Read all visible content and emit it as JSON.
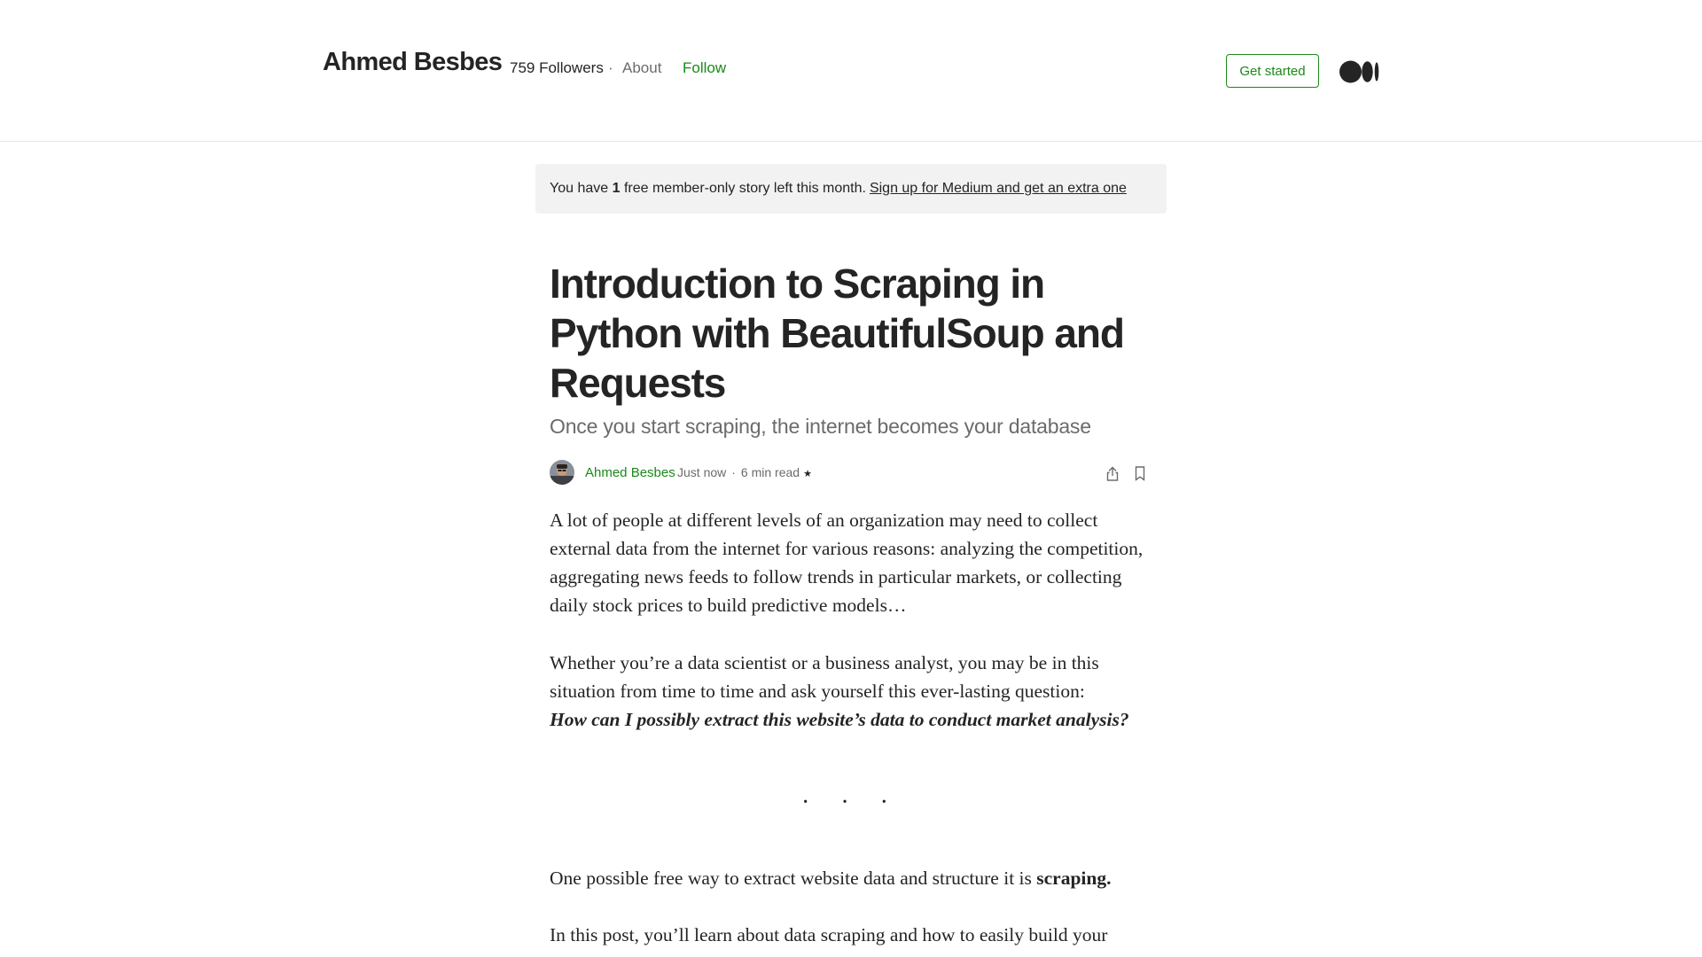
{
  "header": {
    "publication_name": "Ahmed Besbes",
    "followers": "759 Followers",
    "separator": "·",
    "about": "About",
    "follow": "Follow",
    "get_started": "Get started",
    "logo_icon": "medium-logo-icon"
  },
  "banner": {
    "text_before": "You have",
    "count": "1",
    "text_after": "free member-only story left this month.",
    "signup_link": "Sign up for Medium and get an extra one"
  },
  "article": {
    "title": "Introduction to Scraping in Python with BeautifulSoup and Requests",
    "subtitle": "Once you start scraping, the internet becomes your database",
    "author": "Ahmed Besbes",
    "posted": "Just now",
    "meta_separator": "·",
    "read_time": "6 min read",
    "member_icon": "star-icon",
    "paragraphs": {
      "p1": "A lot of people at different levels of an organization may need to collect external data from the internet for various reasons: analyzing the competition, aggregating news feeds to follow trends in particular markets, or collecting daily stock prices to build predictive models…",
      "p2": "Whether you’re a data scientist or a business analyst, you may be in this situation from time to time and ask yourself this ever-lasting question:",
      "p2_emphasis": "How can I possibly extract this website’s data to conduct market analysis?",
      "separator": "· · ·",
      "p3": "One possible free way to extract website data and structure it is",
      "p3_bold": "scraping.",
      "p4": "In this post, you’ll learn about data scraping and how to easily build your"
    }
  },
  "colors": {
    "accent_green": "#1a8917",
    "text": "#242424",
    "muted": "#6b6b6b",
    "banner_bg": "#f2f2f2"
  }
}
